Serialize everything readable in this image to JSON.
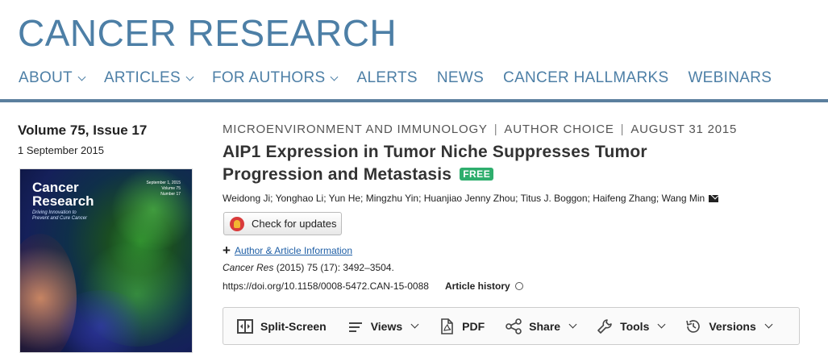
{
  "site": {
    "title": "CANCER RESEARCH"
  },
  "nav": {
    "items": [
      {
        "label": "ABOUT",
        "has_dropdown": true
      },
      {
        "label": "ARTICLES",
        "has_dropdown": true
      },
      {
        "label": "FOR AUTHORS",
        "has_dropdown": true
      },
      {
        "label": "ALERTS",
        "has_dropdown": false
      },
      {
        "label": "NEWS",
        "has_dropdown": false
      },
      {
        "label": "CANCER HALLMARKS",
        "has_dropdown": false
      },
      {
        "label": "WEBINARS",
        "has_dropdown": false
      }
    ]
  },
  "issue": {
    "volume": "Volume 75, Issue 17",
    "date": "1 September 2015",
    "cover": {
      "title_line1": "Cancer",
      "title_line2": "Research",
      "tagline_line1": "Driving Innovation to",
      "tagline_line2": "Prevent and Cure Cancer",
      "meta_line1": "September 1, 2015",
      "meta_line2": "Volume 75",
      "meta_line3": "Number 17"
    }
  },
  "article": {
    "category": "MICROENVIRONMENT AND IMMUNOLOGY",
    "access": "AUTHOR CHOICE",
    "pub_date": "AUGUST 31 2015",
    "title": "AIP1 Expression in Tumor Niche Suppresses Tumor Progression and Metastasis",
    "badge": "FREE",
    "authors": "Weidong Ji; Yonghao Li; Yun He; Mingzhu Yin; Huanjiao Jenny Zhou; Titus J. Boggon; Haifeng Zhang; Wang Min",
    "check_updates": "Check for updates",
    "author_info_link": "Author & Article Information",
    "citation_journal": "Cancer Res",
    "citation_rest": " (2015) 75 (17): 3492–3504.",
    "doi": "https://doi.org/10.1158/0008-5472.CAN-15-0088",
    "history": "Article history"
  },
  "toolbar": {
    "split_screen": "Split-Screen",
    "views": "Views",
    "pdf": "PDF",
    "share": "Share",
    "tools": "Tools",
    "versions": "Versions"
  },
  "colors": {
    "brand": "#4d7fa6",
    "badge": "#2eae6d",
    "link": "#1f5fa6"
  }
}
